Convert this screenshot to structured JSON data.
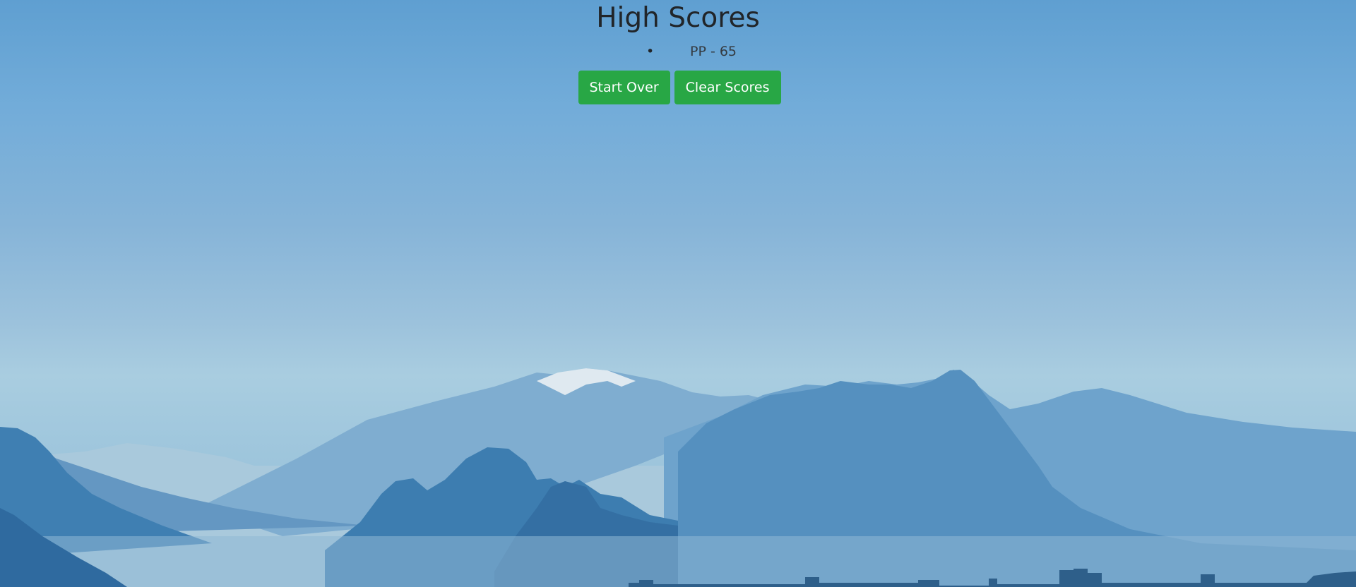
{
  "page": {
    "title": "High Scores"
  },
  "scores": [
    {
      "text": "PP - 65"
    }
  ],
  "buttons": {
    "start_over": "Start Over",
    "clear_scores": "Clear Scores"
  },
  "colors": {
    "button_green": "#28a745",
    "title_text": "#212529"
  }
}
